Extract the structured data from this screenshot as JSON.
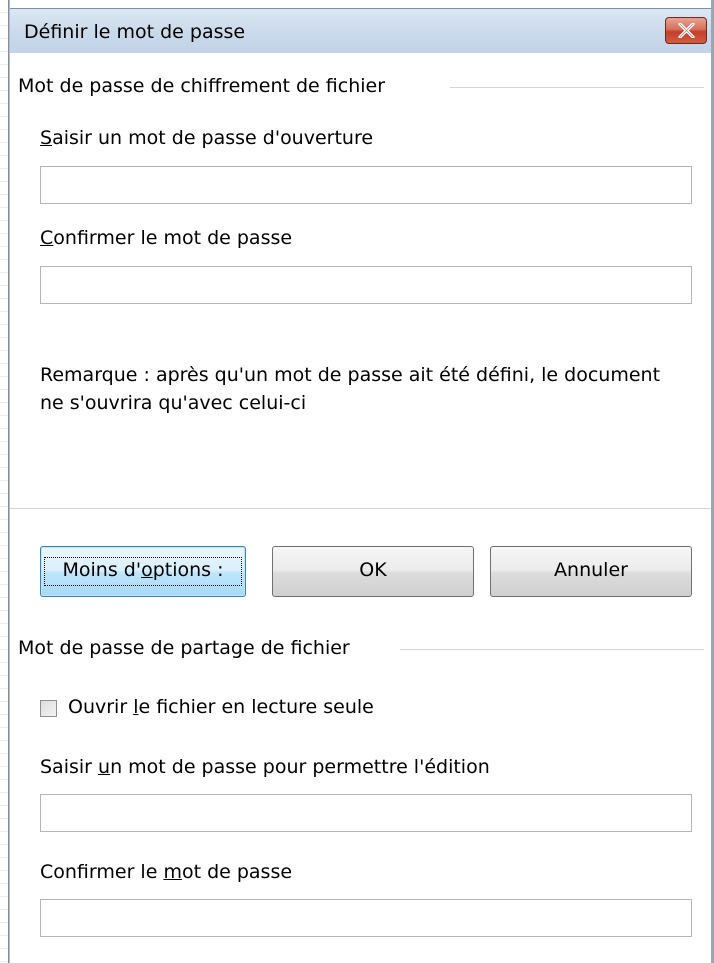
{
  "window": {
    "title": "Définir le mot de passe",
    "close_icon": "close-icon"
  },
  "encryption": {
    "section_title": "Mot de passe de chiffrement de fichier",
    "open_password_label_key": "S",
    "open_password_label_rest": "aisir un mot de passe d'ouverture",
    "open_password_value": "",
    "confirm_label_key": "C",
    "confirm_label_rest": "onfirmer le mot de passe",
    "confirm_value": "",
    "note": "Remarque : après qu'un mot de passe ait été défini, le document ne s'ouvrira qu'avec celui-ci"
  },
  "buttons": {
    "fewer_options_pre": "Moins d'",
    "fewer_options_key": "o",
    "fewer_options_post": "ptions :",
    "ok": "OK",
    "cancel": "Annuler"
  },
  "sharing": {
    "section_title": "Mot de passe de partage de fichier",
    "readonly_pre": "Ouvrir ",
    "readonly_key": "l",
    "readonly_post": "e fichier en lecture seule",
    "readonly_checked": false,
    "edit_password_pre": "Saisir ",
    "edit_password_key": "u",
    "edit_password_post": "n mot de passe pour permettre l'édition",
    "edit_password_value": "",
    "confirm_pre": "Confirmer le ",
    "confirm_key": "m",
    "confirm_post": "ot de passe",
    "confirm_value": ""
  }
}
